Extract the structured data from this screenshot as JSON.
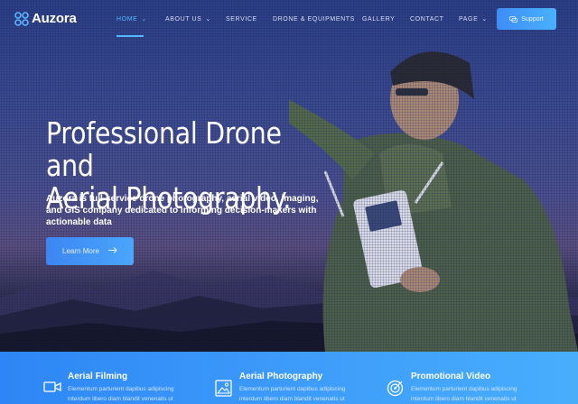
{
  "brand": {
    "name": "Auzora"
  },
  "nav": {
    "items": [
      {
        "label": "HOME",
        "has_dropdown": true,
        "active": true
      },
      {
        "label": "ABOUT US",
        "has_dropdown": true,
        "active": false
      },
      {
        "label": "SERVICE",
        "has_dropdown": false,
        "active": false
      },
      {
        "label": "DRONE & EQUIPMENTS",
        "has_dropdown": false,
        "active": false
      },
      {
        "label": "GALLERY",
        "has_dropdown": false,
        "active": false
      },
      {
        "label": "CONTACT",
        "has_dropdown": false,
        "active": false
      },
      {
        "label": "PAGE",
        "has_dropdown": true,
        "active": false
      }
    ],
    "support_label": "Support"
  },
  "hero": {
    "headline_line1": "Professional Drone and",
    "headline_line2": "Aerial Photography.",
    "description": "Auzora is full-service drone photography, aerial video, imaging, and GIS company dedicated to informing decision-makers with actionable data",
    "cta_label": "Learn More"
  },
  "services": [
    {
      "title": "Aerial Filming",
      "icon": "video-camera-icon",
      "description": "Elementum parturient dapibus adipiscing interdum libero diam blandit venenatis ut"
    },
    {
      "title": "Aerial Photography",
      "icon": "image-frame-icon",
      "description": "Elementum parturient dapibus adipiscing interdum libero diam blandit venenatis ut"
    },
    {
      "title": "Promotional Video",
      "icon": "target-icon",
      "description": "Elementum parturient dapibus adipiscing interdum libero diam blandit venenatis ut"
    }
  ],
  "colors": {
    "accent": "#4fb8ff",
    "button_blue": "#3d8df7",
    "strip_blue": "#3d9bfa"
  }
}
